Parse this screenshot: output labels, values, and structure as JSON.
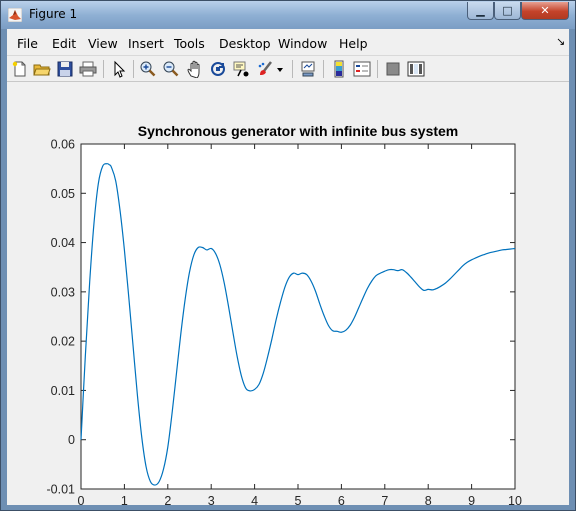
{
  "window": {
    "title": "Figure 1",
    "minimize_glyph": "▁",
    "maximize_glyph": "□",
    "close_glyph": "✕"
  },
  "menu": {
    "items": [
      "File",
      "Edit",
      "View",
      "Insert",
      "Tools",
      "Desktop",
      "Window",
      "Help"
    ],
    "dock_arrow": "↘"
  },
  "toolbar": {
    "icons": [
      "new-figure-icon",
      "open-file-icon",
      "save-icon",
      "print-icon",
      "pointer-icon",
      "zoom-in-icon",
      "zoom-out-icon",
      "pan-icon",
      "rotate-3d-icon",
      "data-cursor-icon",
      "brush-icon",
      "brush-dropdown-icon",
      "link-plot-icon",
      "insert-colorbar-icon",
      "insert-legend-icon",
      "hide-plot-tools-icon",
      "show-plot-tools-icon"
    ]
  },
  "chart_data": {
    "type": "line",
    "title": "Synchronous generator with infinite bus system",
    "xlabel": "",
    "ylabel": "",
    "xlim": [
      0,
      10
    ],
    "ylim": [
      -0.01,
      0.06
    ],
    "xticks": [
      0,
      1,
      2,
      3,
      4,
      5,
      6,
      7,
      8,
      9,
      10
    ],
    "yticks": [
      -0.01,
      0,
      0.01,
      0.02,
      0.03,
      0.04,
      0.05,
      0.06
    ],
    "ytick_labels": [
      "-0.01",
      "0",
      "0.01",
      "0.02",
      "0.03",
      "0.04",
      "0.05",
      "0.06"
    ],
    "grid": false,
    "line_color": "#0072bd",
    "series": [
      {
        "x": [
          0,
          0.1,
          0.2,
          0.3,
          0.4,
          0.5,
          0.6,
          0.65,
          0.7,
          0.8,
          0.9,
          1.0,
          1.1,
          1.2,
          1.3,
          1.4,
          1.5,
          1.6,
          1.7,
          1.8,
          1.9,
          2.0,
          2.1,
          2.2,
          2.3,
          2.4,
          2.5,
          2.6,
          2.7,
          2.8,
          2.9,
          3.0,
          3.1,
          3.2,
          3.3,
          3.4,
          3.5,
          3.6,
          3.7,
          3.8,
          3.9,
          4.0,
          4.1,
          4.2,
          4.3,
          4.4,
          4.5,
          4.6,
          4.7,
          4.8,
          4.9,
          5.0,
          5.1,
          5.2,
          5.3,
          5.4,
          5.5,
          5.6,
          5.7,
          5.8,
          5.9,
          6.0,
          6.1,
          6.2,
          6.3,
          6.4,
          6.5,
          6.6,
          6.7,
          6.8,
          6.9,
          7.0,
          7.1,
          7.2,
          7.3,
          7.4,
          7.5,
          7.6,
          7.7,
          7.8,
          7.9,
          8.0,
          8.1,
          8.2,
          8.3,
          8.4,
          8.5,
          8.6,
          8.7,
          8.8,
          8.9,
          9.0,
          9.1,
          9.2,
          9.3,
          9.4,
          9.5,
          9.6,
          9.7,
          9.8,
          9.9,
          10.0
        ],
        "values": [
          0.0,
          0.017,
          0.032,
          0.044,
          0.052,
          0.0555,
          0.056,
          0.0558,
          0.0553,
          0.0525,
          0.0465,
          0.0385,
          0.029,
          0.019,
          0.009,
          0.0005,
          -0.0055,
          -0.0085,
          -0.0092,
          -0.0085,
          -0.006,
          -0.0015,
          0.0055,
          0.0135,
          0.0215,
          0.0285,
          0.034,
          0.0375,
          0.039,
          0.039,
          0.0385,
          0.0388,
          0.0378,
          0.0355,
          0.0318,
          0.027,
          0.0218,
          0.0168,
          0.0128,
          0.0104,
          0.0099,
          0.0102,
          0.0112,
          0.0135,
          0.0168,
          0.0205,
          0.0245,
          0.028,
          0.031,
          0.033,
          0.0338,
          0.0335,
          0.0338,
          0.0335,
          0.0322,
          0.0302,
          0.0276,
          0.0252,
          0.0232,
          0.0221,
          0.022,
          0.0218,
          0.0222,
          0.0232,
          0.0248,
          0.0268,
          0.0288,
          0.0307,
          0.0322,
          0.0333,
          0.0338,
          0.0342,
          0.0345,
          0.0345,
          0.0343,
          0.0345,
          0.0339,
          0.033,
          0.032,
          0.031,
          0.0303,
          0.0305,
          0.0304,
          0.0307,
          0.0312,
          0.0318,
          0.0326,
          0.0335,
          0.0344,
          0.0353,
          0.036,
          0.0365,
          0.0369,
          0.0373,
          0.0376,
          0.0379,
          0.0381,
          0.0383,
          0.0385,
          0.0386,
          0.0387,
          0.0388
        ]
      }
    ]
  }
}
